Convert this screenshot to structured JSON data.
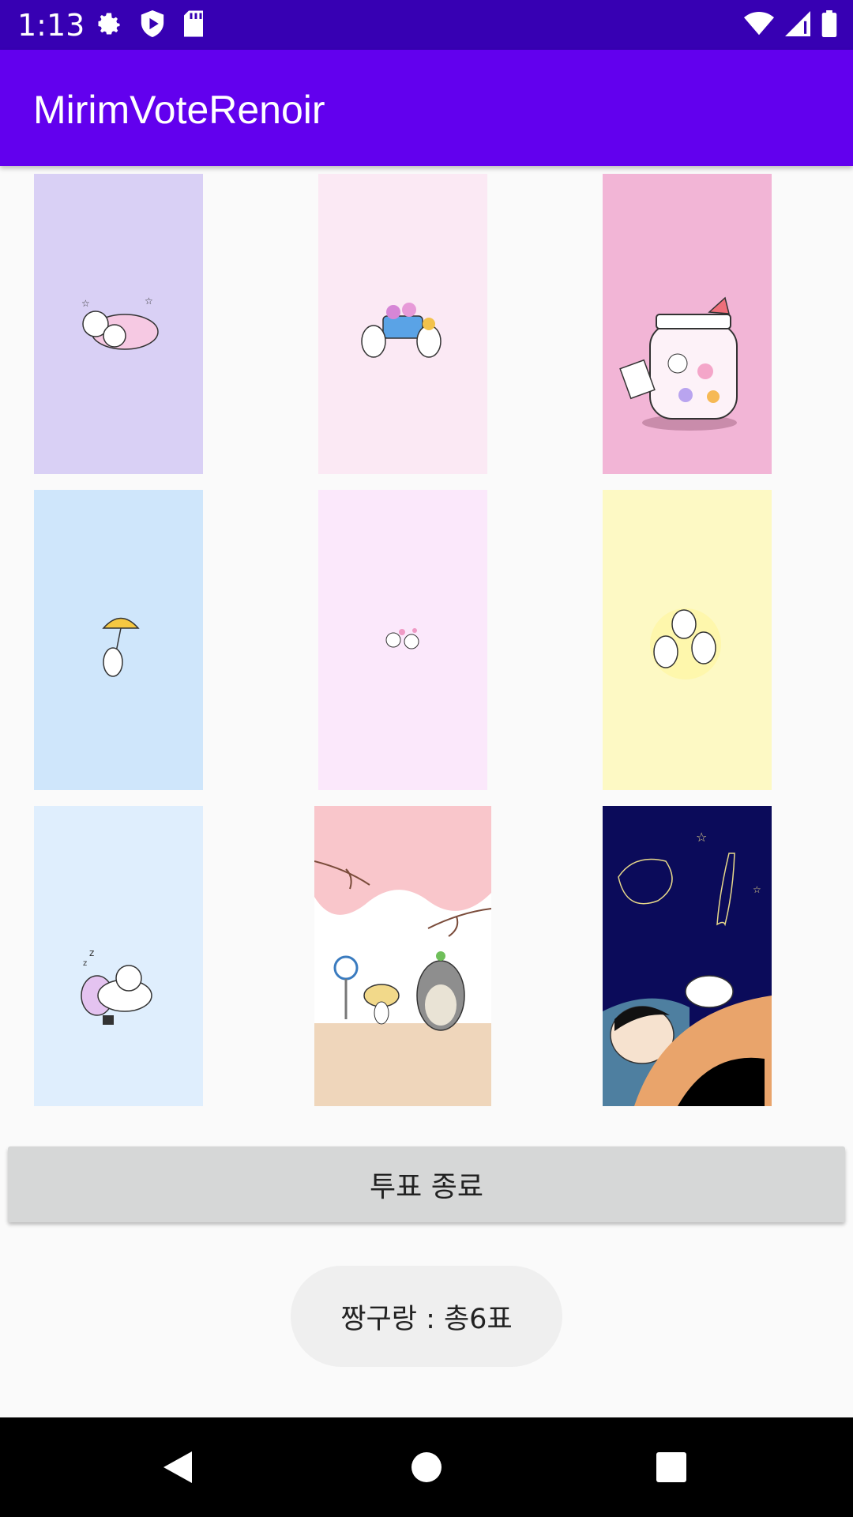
{
  "status_bar": {
    "time": "1:13",
    "left_icons": [
      "gear-icon",
      "play-protect-icon",
      "sd-card-icon"
    ],
    "right_icons": [
      "wifi-icon",
      "signal-icon",
      "battery-icon"
    ]
  },
  "app_bar": {
    "title": "MirimVoteRenoir"
  },
  "gallery": {
    "images": [
      {
        "name": "sleeping-bears-lavender",
        "background": "#d9d0f5"
      },
      {
        "name": "bears-carrying-basket-pink",
        "background": "#fbe9f4"
      },
      {
        "name": "candy-jar-pink",
        "background": "#f2b5d6"
      },
      {
        "name": "bear-umbrella-blue",
        "background": "#cfe6fb"
      },
      {
        "name": "tiny-bears-pink",
        "background": "#fbe8fb"
      },
      {
        "name": "three-bears-yellow",
        "background": "#fdf9c4"
      },
      {
        "name": "sleeping-bunny-blue",
        "background": "#dfeefd"
      },
      {
        "name": "totoro-cherry-blossom",
        "background": "#ffffff"
      },
      {
        "name": "shinchan-night",
        "background": "#0b0b5a"
      }
    ]
  },
  "controls": {
    "end_vote_label": "투표 종료"
  },
  "toast": {
    "message": "짱구랑 : 총6표"
  },
  "nav_bar": {
    "icons": [
      "back-icon",
      "home-icon",
      "recents-icon"
    ]
  }
}
